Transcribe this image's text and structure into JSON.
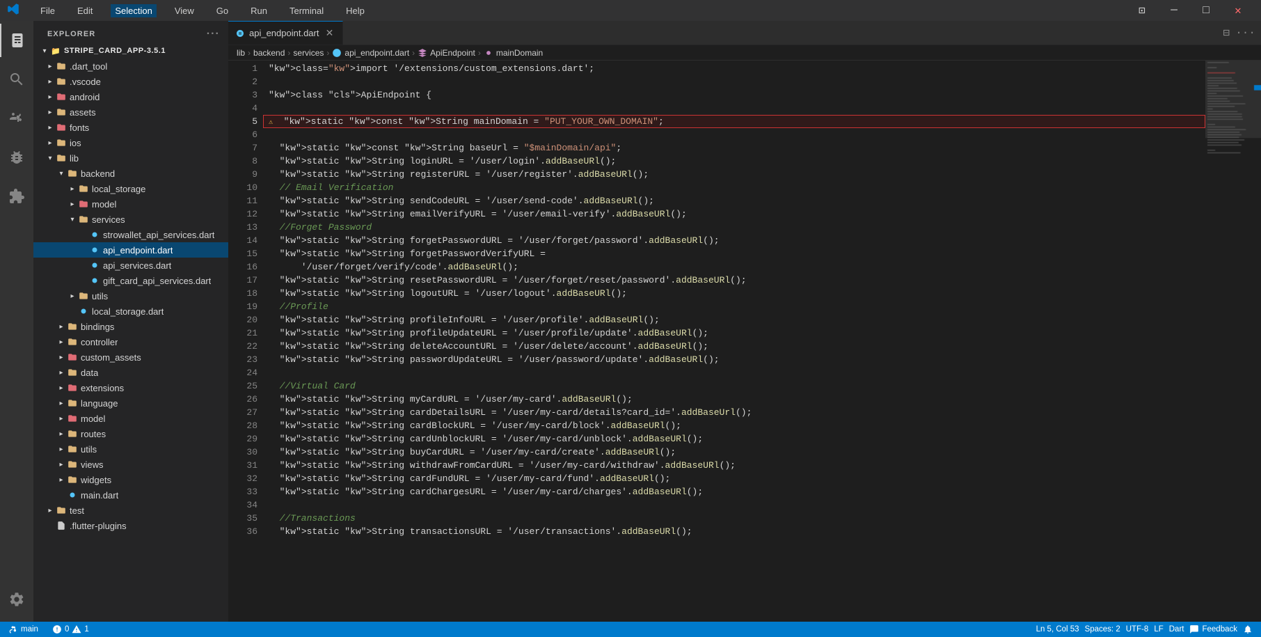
{
  "titlebar": {
    "menus": [
      "File",
      "Edit",
      "Selection",
      "View",
      "Go",
      "Run",
      "Terminal",
      "Help"
    ]
  },
  "sidebar": {
    "header": "EXPLORER",
    "project": "STRIPE_CARD_APP-3.5.1",
    "tree": [
      {
        "id": "dart_tool",
        "label": ".dart_tool",
        "type": "folder",
        "depth": 1,
        "open": false
      },
      {
        "id": "vscode",
        "label": ".vscode",
        "type": "folder",
        "depth": 1,
        "open": false
      },
      {
        "id": "android",
        "label": "android",
        "type": "folder-red",
        "depth": 1,
        "open": false
      },
      {
        "id": "assets",
        "label": "assets",
        "type": "folder",
        "depth": 1,
        "open": false
      },
      {
        "id": "fonts",
        "label": "fonts",
        "type": "folder-red",
        "depth": 1,
        "open": false
      },
      {
        "id": "ios",
        "label": "ios",
        "type": "folder",
        "depth": 1,
        "open": false
      },
      {
        "id": "lib",
        "label": "lib",
        "type": "folder",
        "depth": 1,
        "open": true
      },
      {
        "id": "backend",
        "label": "backend",
        "type": "folder",
        "depth": 2,
        "open": true
      },
      {
        "id": "local_storage",
        "label": "local_storage",
        "type": "folder",
        "depth": 3,
        "open": false
      },
      {
        "id": "model",
        "label": "model",
        "type": "folder-red",
        "depth": 3,
        "open": false
      },
      {
        "id": "services",
        "label": "services",
        "type": "folder",
        "depth": 3,
        "open": true
      },
      {
        "id": "strowallet_api",
        "label": "strowallet_api_services.dart",
        "type": "dart",
        "depth": 4,
        "open": false
      },
      {
        "id": "api_endpoint",
        "label": "api_endpoint.dart",
        "type": "dart",
        "depth": 4,
        "open": false,
        "active": true
      },
      {
        "id": "api_services",
        "label": "api_services.dart",
        "type": "dart",
        "depth": 4,
        "open": false
      },
      {
        "id": "gift_card",
        "label": "gift_card_api_services.dart",
        "type": "dart",
        "depth": 4,
        "open": false
      },
      {
        "id": "utils",
        "label": "utils",
        "type": "folder",
        "depth": 3,
        "open": false
      },
      {
        "id": "local_storage_dart",
        "label": "local_storage.dart",
        "type": "dart",
        "depth": 3,
        "open": false
      },
      {
        "id": "bindings",
        "label": "bindings",
        "type": "folder",
        "depth": 2,
        "open": false
      },
      {
        "id": "controller",
        "label": "controller",
        "type": "folder",
        "depth": 2,
        "open": false
      },
      {
        "id": "custom_assets",
        "label": "custom_assets",
        "type": "folder-red",
        "depth": 2,
        "open": false
      },
      {
        "id": "data",
        "label": "data",
        "type": "folder",
        "depth": 2,
        "open": false
      },
      {
        "id": "extensions",
        "label": "extensions",
        "type": "folder-red",
        "depth": 2,
        "open": false
      },
      {
        "id": "language",
        "label": "language",
        "type": "folder",
        "depth": 2,
        "open": false
      },
      {
        "id": "model2",
        "label": "model",
        "type": "folder-red",
        "depth": 2,
        "open": false
      },
      {
        "id": "routes",
        "label": "routes",
        "type": "folder",
        "depth": 2,
        "open": false
      },
      {
        "id": "utils2",
        "label": "utils",
        "type": "folder",
        "depth": 2,
        "open": false
      },
      {
        "id": "views",
        "label": "views",
        "type": "folder",
        "depth": 2,
        "open": false
      },
      {
        "id": "widgets",
        "label": "widgets",
        "type": "folder",
        "depth": 2,
        "open": false
      },
      {
        "id": "main_dart",
        "label": "main.dart",
        "type": "dart",
        "depth": 2,
        "open": false
      },
      {
        "id": "test",
        "label": "test",
        "type": "folder",
        "depth": 1,
        "open": false
      },
      {
        "id": "flutter_plugins",
        "label": ".flutter-plugins",
        "type": "file",
        "depth": 1,
        "open": false
      }
    ]
  },
  "tab": {
    "filename": "api_endpoint.dart",
    "icon_color": "#54c5f8"
  },
  "breadcrumb": {
    "items": [
      "lib",
      "backend",
      "services",
      "api_endpoint.dart",
      "ApiEndpoint",
      "mainDomain"
    ]
  },
  "code": {
    "lines": [
      {
        "n": 1,
        "text": "import '/extensions/custom_extensions.dart';"
      },
      {
        "n": 2,
        "text": ""
      },
      {
        "n": 3,
        "text": "class ApiEndpoint {"
      },
      {
        "n": 4,
        "text": ""
      },
      {
        "n": 5,
        "text": "  static const String mainDomain = \"PUT_YOUR_OWN_DOMAIN\";",
        "highlight": true,
        "warning": true
      },
      {
        "n": 6,
        "text": ""
      },
      {
        "n": 7,
        "text": "  static const String baseUrl = \"$mainDomain/api\";"
      },
      {
        "n": 8,
        "text": "  static String loginURL = '/user/login'.addBaseURl();"
      },
      {
        "n": 9,
        "text": "  static String registerURL = '/user/register'.addBaseURl();"
      },
      {
        "n": 10,
        "text": "  // Email Verification"
      },
      {
        "n": 11,
        "text": "  static String sendCodeURL = '/user/send-code'.addBaseURl();"
      },
      {
        "n": 12,
        "text": "  static String emailVerifyURL = '/user/email-verify'.addBaseURl();"
      },
      {
        "n": 13,
        "text": "  //Forget Password"
      },
      {
        "n": 14,
        "text": "  static String forgetPasswordURL = '/user/forget/password'.addBaseURl();"
      },
      {
        "n": 15,
        "text": "  static String forgetPasswordVerifyURL ="
      },
      {
        "n": 16,
        "text": "      '/user/forget/verify/code'.addBaseURl();"
      },
      {
        "n": 17,
        "text": "  static String resetPasswordURL = '/user/forget/reset/password'.addBaseURl();"
      },
      {
        "n": 18,
        "text": "  static String logoutURL = '/user/logout'.addBaseURl();"
      },
      {
        "n": 19,
        "text": "  //Profile"
      },
      {
        "n": 20,
        "text": "  static String profileInfoURL = '/user/profile'.addBaseURl();"
      },
      {
        "n": 21,
        "text": "  static String profileUpdateURL = '/user/profile/update'.addBaseURl();"
      },
      {
        "n": 22,
        "text": "  static String deleteAccountURL = '/user/delete/account'.addBaseURl();"
      },
      {
        "n": 23,
        "text": "  static String passwordUpdateURL = '/user/password/update'.addBaseURl();"
      },
      {
        "n": 24,
        "text": ""
      },
      {
        "n": 25,
        "text": "  //Virtual Card"
      },
      {
        "n": 26,
        "text": "  static String myCardURL = '/user/my-card'.addBaseURl();"
      },
      {
        "n": 27,
        "text": "  static String cardDetailsURL = '/user/my-card/details?card_id='.addBaseUrl();"
      },
      {
        "n": 28,
        "text": "  static String cardBlockURL = '/user/my-card/block'.addBaseURl();"
      },
      {
        "n": 29,
        "text": "  static String cardUnblockURL = '/user/my-card/unblock'.addBaseURl();"
      },
      {
        "n": 30,
        "text": "  static String buyCardURL = '/user/my-card/create'.addBaseURl();"
      },
      {
        "n": 31,
        "text": "  static String withdrawFromCardURL = '/user/my-card/withdraw'.addBaseURl();"
      },
      {
        "n": 32,
        "text": "  static String cardFundURL = '/user/my-card/fund'.addBaseURl();"
      },
      {
        "n": 33,
        "text": "  static String cardChargesURL = '/user/my-card/charges'.addBaseURl();"
      },
      {
        "n": 34,
        "text": ""
      },
      {
        "n": 35,
        "text": "  //Transactions"
      },
      {
        "n": 36,
        "text": "  static String transactionsURL = '/user/transactions'.addBaseURl();"
      }
    ]
  },
  "statusbar": {
    "branch": "main",
    "errors": "0",
    "warnings": "1",
    "line": "Ln 5, Col 53",
    "spaces": "Spaces: 2",
    "encoding": "UTF-8",
    "eol": "LF",
    "language": "Dart",
    "feedback": "Feedback"
  }
}
